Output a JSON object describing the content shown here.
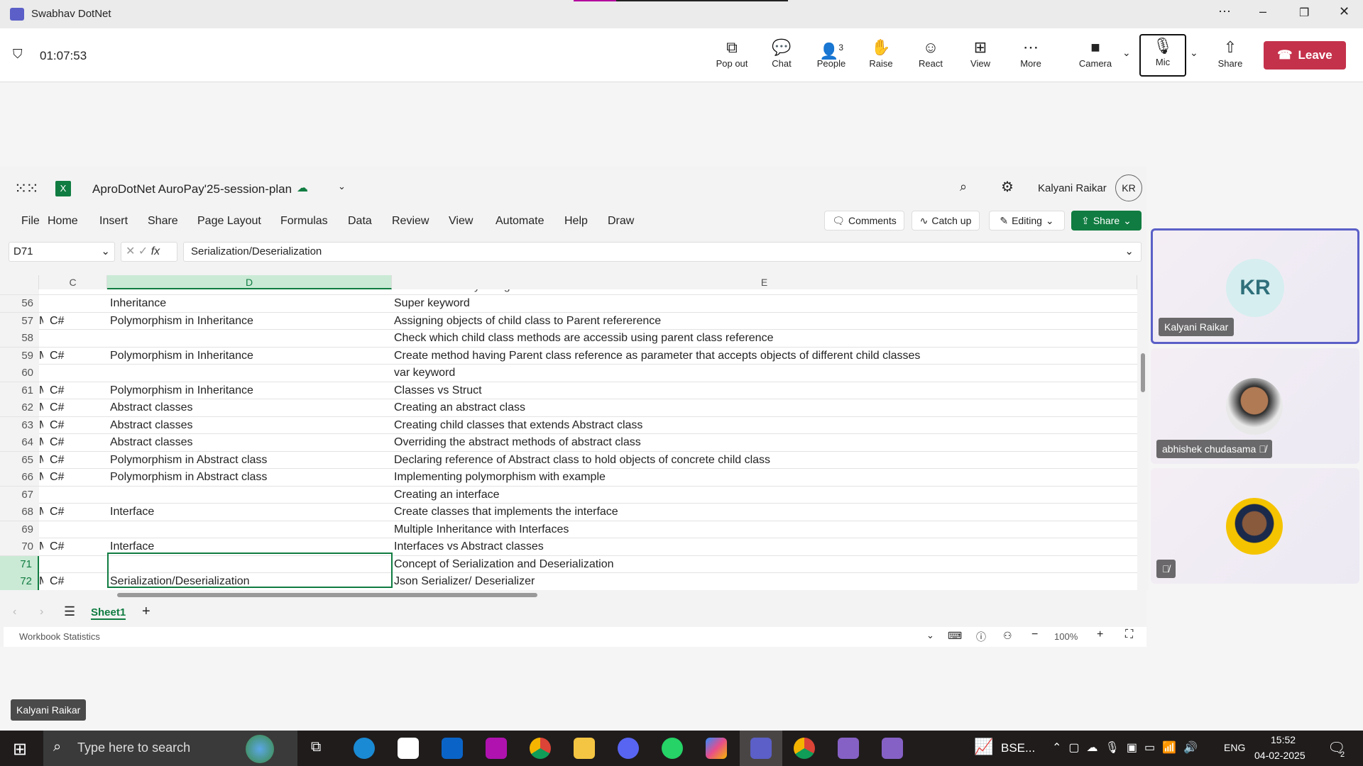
{
  "window": {
    "title": "Swabhav DotNet"
  },
  "meeting": {
    "timer": "01:07:53",
    "buttons": [
      {
        "label": "Pop out",
        "icon": "pop-out-icon",
        "g": "⧉"
      },
      {
        "label": "Chat",
        "icon": "chat-icon",
        "g": "💬"
      },
      {
        "label": "People",
        "icon": "people-icon",
        "g": "👤",
        "count": "3"
      },
      {
        "label": "Raise",
        "icon": "raise-hand-icon",
        "g": "✋"
      },
      {
        "label": "React",
        "icon": "react-icon",
        "g": "☺"
      },
      {
        "label": "View",
        "icon": "view-icon",
        "g": "⊞"
      },
      {
        "label": "More",
        "icon": "more-icon",
        "g": "⋯"
      },
      {
        "label": "Camera",
        "icon": "camera-off-icon",
        "g": "■"
      },
      {
        "label": "Mic",
        "icon": "mic-off-icon",
        "g": "🎙"
      },
      {
        "label": "Share",
        "icon": "share-icon",
        "g": "⇧"
      }
    ],
    "leave": "Leave",
    "presenter_label": "Kalyani Raikar"
  },
  "excel": {
    "file": "AproDotNet AuroPay'25-session-plan",
    "user": "Kalyani Raikar",
    "initials": "KR",
    "menu": [
      "File",
      "Home",
      "Insert",
      "Share",
      "Page Layout",
      "Formulas",
      "Data",
      "Review",
      "View",
      "Automate",
      "Help",
      "Draw"
    ],
    "comments": "Comments",
    "catchup": "Catch up",
    "editing": "Editing",
    "share": "Share",
    "namebox": "D71",
    "formula": "Serialization/Deserialization",
    "columns": [
      "C",
      "D",
      "E"
    ],
    "partial": "Code Reusability using Inheritance",
    "rows": [
      {
        "n": "56",
        "b": "",
        "c": "",
        "d": "Inheritance",
        "e": "Super keyword"
      },
      {
        "n": "57",
        "b": "M",
        "c": "C#",
        "d": "Polymorphism in Inheritance",
        "e": "Assigning objects of child class to Parent refererence"
      },
      {
        "n": "58",
        "b": "",
        "c": "",
        "d": "",
        "e": "Check which child class methods are accessib using parent class reference"
      },
      {
        "n": "59",
        "b": "M",
        "c": "C#",
        "d": "Polymorphism in Inheritance",
        "e": "Create method having Parent class reference as parameter that accepts objects of different child classes"
      },
      {
        "n": "60",
        "b": "",
        "c": "",
        "d": "",
        "e": "var keyword"
      },
      {
        "n": "61",
        "b": "M",
        "c": "C#",
        "d": "Polymorphism in Inheritance",
        "e": "Classes vs Struct"
      },
      {
        "n": "62",
        "b": "M",
        "c": "C#",
        "d": "Abstract classes",
        "e": "Creating an abstract class"
      },
      {
        "n": "63",
        "b": "M",
        "c": "C#",
        "d": "Abstract classes",
        "e": "Creating child classes that extends Abstract class"
      },
      {
        "n": "64",
        "b": "M",
        "c": "C#",
        "d": "Abstract classes",
        "e": "Overriding the abstract methods of abstract class"
      },
      {
        "n": "65",
        "b": "M",
        "c": "C#",
        "d": "Polymorphism in Abstract class",
        "e": "Declaring reference of Abstract class to hold objects of concrete child class"
      },
      {
        "n": "66",
        "b": "M",
        "c": "C#",
        "d": "Polymorphism in Abstract class",
        "e": "Implementing polymorphism with example"
      },
      {
        "n": "67",
        "b": "",
        "c": "",
        "d": "",
        "e": "Creating an interface"
      },
      {
        "n": "68",
        "b": "M",
        "c": "C#",
        "d": "Interface",
        "e": "Create classes that implements the interface"
      },
      {
        "n": "69",
        "b": "",
        "c": "",
        "d": "",
        "e": "Multiple Inheritance with Interfaces"
      },
      {
        "n": "70",
        "b": "M",
        "c": "C#",
        "d": "Interface",
        "e": "Interfaces vs Abstract classes"
      },
      {
        "n": "71",
        "b": "",
        "c": "",
        "d": "",
        "e": "Concept of Serialization and Deserialization"
      },
      {
        "n": "72",
        "b": "M",
        "c": "C#",
        "d": "Serialization/Deserialization",
        "e": "Json Serializer/ Deserializer"
      }
    ],
    "sheet": "Sheet1",
    "status": "Workbook Statistics",
    "zoom": "100%"
  },
  "participants": [
    {
      "name": "Kalyani Raikar",
      "initials": "KR"
    },
    {
      "name": "abhishek chudasama"
    },
    {
      "name": ""
    }
  ],
  "taskbar": {
    "search": "Type here to search",
    "bse": "BSE...",
    "lang": "ENG",
    "time": "15:52",
    "date": "04-02-2025",
    "notif": "2"
  }
}
